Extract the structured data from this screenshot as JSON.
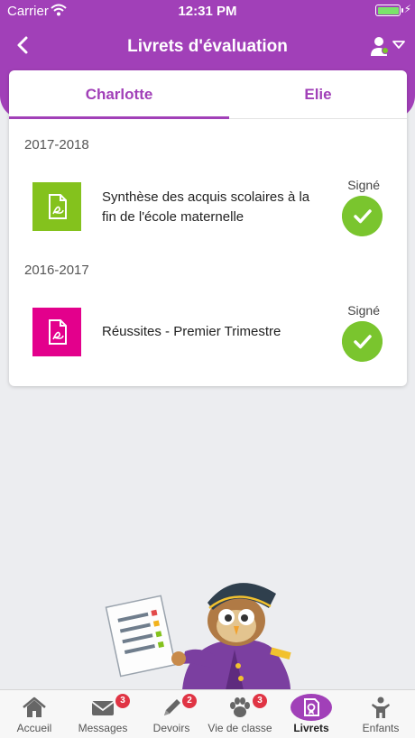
{
  "status_bar": {
    "carrier": "Carrier",
    "time": "12:31 PM"
  },
  "header": {
    "title": "Livrets d'évaluation"
  },
  "tabs": [
    {
      "label": "Charlotte",
      "active": true
    },
    {
      "label": "Elie",
      "active": false
    }
  ],
  "sections": [
    {
      "year": "2017-2018",
      "document": {
        "title": "Synthèse des acquis scolaires à la fin de l'école maternelle",
        "status": "Signé",
        "tile_color": "#84c21d"
      }
    },
    {
      "year": "2016-2017",
      "document": {
        "title": "Réussites - Premier Trimestre",
        "status": "Signé",
        "tile_color": "#e3008c"
      }
    }
  ],
  "tabbar": [
    {
      "label": "Accueil",
      "icon": "home-icon"
    },
    {
      "label": "Messages",
      "icon": "envelope-icon",
      "badge": "3"
    },
    {
      "label": "Devoirs",
      "icon": "pencil-icon",
      "badge": "2"
    },
    {
      "label": "Vie de classe",
      "icon": "paw-icon",
      "badge": "3"
    },
    {
      "label": "Livrets",
      "icon": "booklet-icon",
      "active": true
    },
    {
      "label": "Enfants",
      "icon": "child-icon"
    }
  ],
  "colors": {
    "brand": "#a140b8",
    "check": "#7ac52e",
    "badge": "#e03444"
  }
}
